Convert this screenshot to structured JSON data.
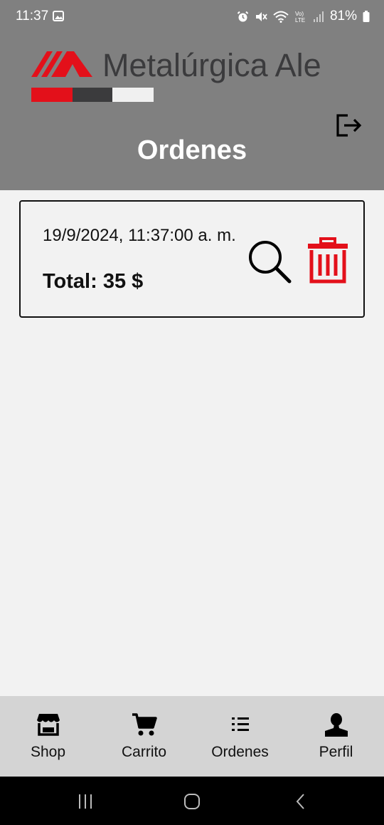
{
  "status_bar": {
    "time": "11:37",
    "battery": "81%",
    "network": "Vo) LTE"
  },
  "header": {
    "logo_text": "Metalúrgica Ale",
    "title": "Ordenes"
  },
  "orders": [
    {
      "date": "19/9/2024, 11:37:00 a. m.",
      "total": "Total: 35 $"
    }
  ],
  "bottom_nav": {
    "items": [
      {
        "label": "Shop",
        "icon": "store-icon"
      },
      {
        "label": "Carrito",
        "icon": "cart-icon"
      },
      {
        "label": "Ordenes",
        "icon": "list-icon"
      },
      {
        "label": "Perfil",
        "icon": "person-icon"
      }
    ]
  },
  "colors": {
    "brand_red": "#e3101a",
    "header_gray": "#808080",
    "nav_gray": "#d4d4d4"
  }
}
